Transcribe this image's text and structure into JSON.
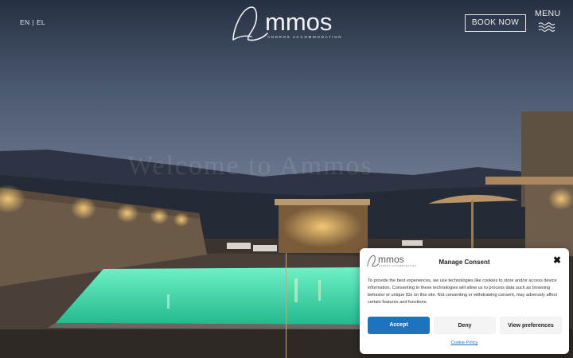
{
  "header": {
    "lang_en": "EN",
    "lang_sep": "|",
    "lang_el": "EL",
    "logo_word": "mmos",
    "logo_tagline": "ANDROS ACCOMMODATION",
    "book_label": "BOOK NOW",
    "menu_label": "MENU",
    "menu_icon": "waves-icon"
  },
  "hero": {
    "welcome_text": "Welcome to Ammos"
  },
  "consent": {
    "logo_word": "mmos",
    "logo_tagline": "ANDROS ACCOMMODATION",
    "title": "Manage Consent",
    "close_icon": "close-icon",
    "body": "To provide the best experiences, we use technologies like cookies to store and/or access device information. Consenting to these technologies will allow us to process data such as browsing behavior or unique IDs on this site. Not consenting or withdrawing consent, may adversely affect certain features and functions.",
    "accept_label": "Accept",
    "deny_label": "Deny",
    "prefs_label": "View preferences",
    "policy_label": "Cookie Policy"
  },
  "colors": {
    "accent_blue": "#1e73be",
    "gold_line": "#d2a566",
    "pool": "#3fd9a8"
  }
}
